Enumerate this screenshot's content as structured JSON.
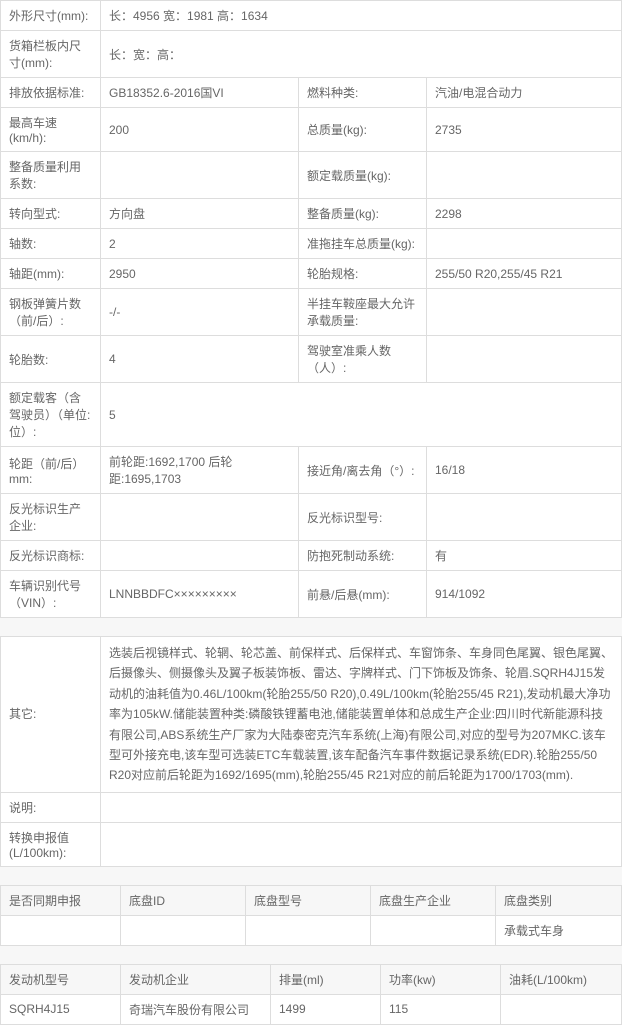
{
  "specs": {
    "r1": {
      "lbl1": "外形尺寸(mm):",
      "val1": "长：4956 宽：1981 高：1634"
    },
    "r2": {
      "lbl1": "货箱栏板内尺寸(mm):",
      "val1": "长：宽：高："
    },
    "r3": {
      "lbl1": "排放依据标准:",
      "val1": "GB18352.6-2016国VI",
      "lbl2": "燃料种类:",
      "val2": "汽油/电混合动力"
    },
    "r4": {
      "lbl1": "最高车速(km/h):",
      "val1": "200",
      "lbl2": "总质量(kg):",
      "val2": "2735"
    },
    "r5": {
      "lbl1": "整备质量利用系数:",
      "val1": "",
      "lbl2": "额定载质量(kg):",
      "val2": ""
    },
    "r6": {
      "lbl1": "转向型式:",
      "val1": "方向盘",
      "lbl2": "整备质量(kg):",
      "val2": "2298"
    },
    "r7": {
      "lbl1": "轴数:",
      "val1": "2",
      "lbl2": "准拖挂车总质量(kg):",
      "val2": ""
    },
    "r8": {
      "lbl1": "轴距(mm):",
      "val1": "2950",
      "lbl2": "轮胎规格:",
      "val2": "255/50 R20,255/45 R21"
    },
    "r9": {
      "lbl1": "钢板弹簧片数（前/后）:",
      "val1": "-/-",
      "lbl2": "半挂车鞍座最大允许承载质量:",
      "val2": ""
    },
    "r10": {
      "lbl1": "轮胎数:",
      "val1": "4",
      "lbl2": "驾驶室准乘人数（人）:",
      "val2": ""
    },
    "r11": {
      "lbl1": "额定载客（含驾驶员）（单位:位）:",
      "val1": "5"
    },
    "r12": {
      "lbl1": "轮距（前/后）mm:",
      "val1": "前轮距:1692,1700 后轮距:1695,1703",
      "lbl2": "接近角/离去角（°）:",
      "val2": "16/18"
    },
    "r13": {
      "lbl1": "反光标识生产企业:",
      "val1": "",
      "lbl2": "反光标识型号:",
      "val2": ""
    },
    "r14": {
      "lbl1": "反光标识商标:",
      "val1": "",
      "lbl2": "防抱死制动系统:",
      "val2": "有"
    },
    "r15": {
      "lbl1": "车辆识别代号（VIN）:",
      "val1": "LNNBBDFC×××××××××",
      "lbl2": "前悬/后悬(mm):",
      "val2": "914/1092"
    }
  },
  "notes": {
    "other_lbl": "其它:",
    "other_val": "选装后视镜样式、轮辋、轮芯盖、前保样式、后保样式、车窗饰条、车身同色尾翼、银色尾翼、后摄像头、侧摄像头及翼子板装饰板、雷达、字牌样式、门下饰板及饰条、轮眉.SQRH4J15发动机的油耗值为0.46L/100km(轮胎255/50 R20),0.49L/100km(轮胎255/45 R21),发动机最大净功率为105kW.储能装置种类:磷酸铁锂蓄电池,储能装置单体和总成生产企业:四川时代新能源科技有限公司,ABS系统生产厂家为大陆泰密克汽车系统(上海)有限公司,对应的型号为207MKC.该车型可外接充电,该车型可选装ETC车载装置,该车配备汽车事件数据记录系统(EDR).轮胎255/50 R20对应前后轮距为1692/1695(mm),轮胎255/45 R21对应的前后轮距为1700/1703(mm).",
    "desc_lbl": "说明:",
    "desc_val": "",
    "fuel_lbl": "转换申报值(L/100km):",
    "fuel_val": ""
  },
  "chassis": {
    "hdr": {
      "c1": "是否同期申报",
      "c2": "底盘ID",
      "c3": "底盘型号",
      "c4": "底盘生产企业",
      "c5": "底盘类别"
    },
    "row": {
      "c1": "",
      "c2": "",
      "c3": "",
      "c4": "",
      "c5": "承载式车身"
    }
  },
  "engine": {
    "hdr": {
      "c1": "发动机型号",
      "c2": "发动机企业",
      "c3": "排量(ml)",
      "c4": "功率(kw)",
      "c5": "油耗(L/100km)"
    },
    "row": {
      "c1": "SQRH4J15",
      "c2": "奇瑞汽车股份有限公司",
      "c3": "1499",
      "c4": "115",
      "c5": ""
    }
  }
}
